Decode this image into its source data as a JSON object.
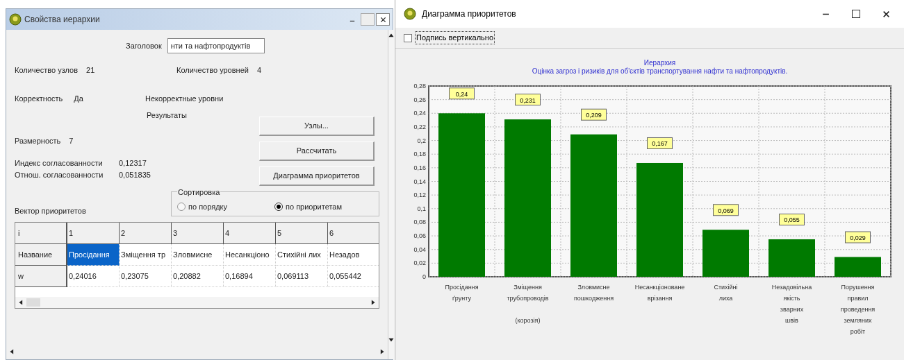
{
  "properties_window": {
    "title": "Свойства иерархии",
    "caption": {
      "label": "Заголовок",
      "value": "нти та нафтопродуктів"
    },
    "node_count": {
      "label": "Количество узлов",
      "value": "21"
    },
    "level_count": {
      "label": "Количество уровней",
      "value": "4"
    },
    "correctness": {
      "label": "Корректность",
      "value": "Да"
    },
    "incorrect_levels": {
      "label": "Некорректные уровни"
    },
    "results_heading": "Результаты",
    "dimension": {
      "label": "Размерность",
      "value": "7"
    },
    "consistency_index": {
      "label": "Индекс согласованности",
      "value": "0,12317"
    },
    "consistency_ratio": {
      "label": "Отнош. согласованности",
      "value": "0,051835"
    },
    "buttons": [
      "Узлы...",
      "Рассчитать",
      "Диаграмма приоритетов"
    ],
    "sorting": {
      "title": "Сортировка",
      "options": [
        {
          "label": "по порядку",
          "selected": false
        },
        {
          "label": "по приоритетам",
          "selected": true
        }
      ]
    },
    "vector_label": "Вектор приоритетов",
    "table": {
      "rows": [
        {
          "header": "i",
          "cells": [
            {
              "text": "1",
              "selected": false
            },
            {
              "text": "2",
              "selected": false
            },
            {
              "text": "3",
              "selected": false
            },
            {
              "text": "4",
              "selected": false
            },
            {
              "text": "5",
              "selected": false
            },
            {
              "text": "6",
              "selected": false
            }
          ]
        },
        {
          "header": "Название",
          "cells": [
            {
              "text": "Просідання",
              "selected": true
            },
            {
              "text": "Зміщення тр",
              "selected": false
            },
            {
              "text": "Зловмисне",
              "selected": false
            },
            {
              "text": "Несанкціоно",
              "selected": false
            },
            {
              "text": "Стихійні лих",
              "selected": false
            },
            {
              "text": "Незадов",
              "selected": false
            }
          ]
        },
        {
          "header": "w",
          "cells": [
            {
              "text": "0,24016",
              "selected": false
            },
            {
              "text": "0,23075",
              "selected": false
            },
            {
              "text": "0,20882",
              "selected": false
            },
            {
              "text": "0,16894",
              "selected": false
            },
            {
              "text": "0,069113",
              "selected": false
            },
            {
              "text": "0,055442",
              "selected": false
            }
          ]
        }
      ]
    }
  },
  "chart_window": {
    "title": "Диаграмма приоритетов",
    "vertical_caption": {
      "label": "Подпись вертикально",
      "checked": false
    },
    "chart_data": {
      "type": "bar",
      "title": "Иерархия\nОцінка загроз і ризиків для об'єктів транспортування нафти та нафтопродуктів.",
      "categories": [
        "Просідання\nґрунту",
        "Зміщення\nтрубопроводів\n\n(корозія)",
        "Зловмисне\nпошкодження",
        "Несанкціоноване\nврізання",
        "Стихійні\nлиха",
        "Незадовільна\nякість\nзварних\nшвів",
        "Порушення\nправил\nпроведення\nземляних\nробіт"
      ],
      "grid": true,
      "series": [
        {
          "color": "#007a00",
          "values": [
            0.24,
            0.231,
            0.209,
            0.167,
            0.069,
            0.055,
            0.029
          ]
        }
      ],
      "value_labels": [
        "0,24",
        "0,231",
        "0,209",
        "0,167",
        "0,069",
        "0,055",
        "0,029"
      ],
      "ylim": [
        0,
        0.28
      ],
      "yticks": [
        {
          "value": 0,
          "label": "0"
        },
        {
          "value": 0.02,
          "label": "0,02"
        },
        {
          "value": 0.04,
          "label": "0,04"
        },
        {
          "value": 0.06,
          "label": "0,06"
        },
        {
          "value": 0.08,
          "label": "0,08"
        },
        {
          "value": 0.1,
          "label": "0,1"
        },
        {
          "value": 0.12,
          "label": "0,12"
        },
        {
          "value": 0.14,
          "label": "0,14"
        },
        {
          "value": 0.16,
          "label": "0,16"
        },
        {
          "value": 0.18,
          "label": "0,18"
        },
        {
          "value": 0.2,
          "label": "0,2"
        },
        {
          "value": 0.22,
          "label": "0,22"
        },
        {
          "value": 0.24,
          "label": "0,24"
        },
        {
          "value": 0.26,
          "label": "0,26"
        },
        {
          "value": 0.28,
          "label": "0,28"
        }
      ]
    }
  }
}
